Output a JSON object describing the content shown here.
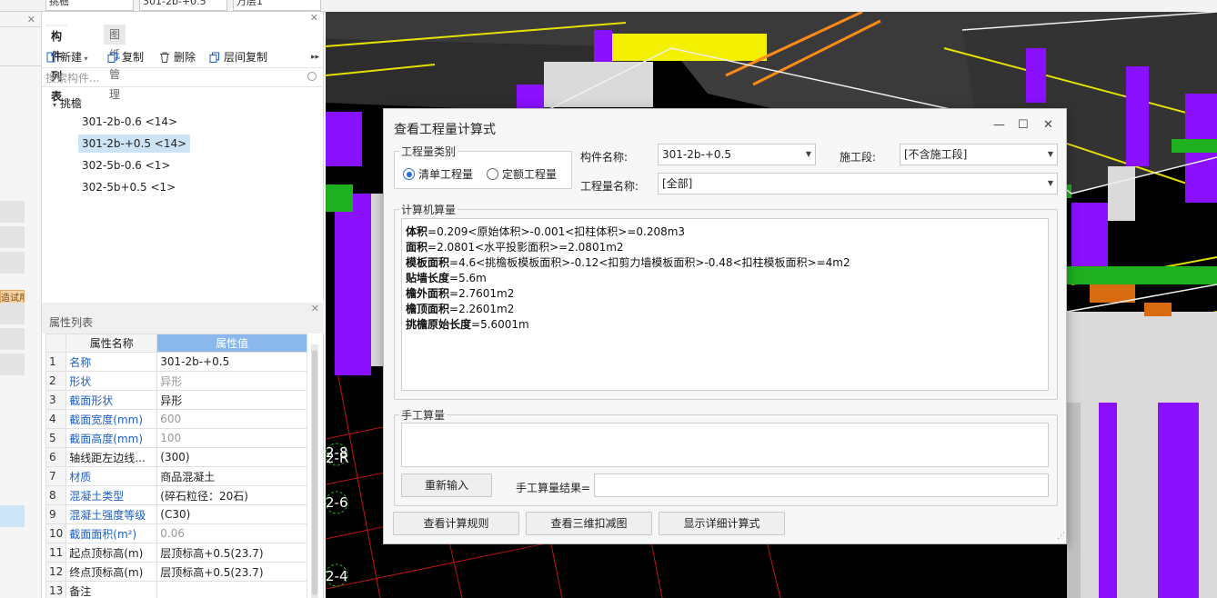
{
  "top_combos": [
    "挑檐",
    "301-2b-+0.5",
    "万层1"
  ],
  "left_strip": {
    "trial_label": "造试用"
  },
  "component_panel": {
    "tabs": [
      "构件列表",
      "图纸管理"
    ],
    "toolbar": {
      "new": "新建",
      "copy": "复制",
      "delete": "删除",
      "layer_copy": "层间复制"
    },
    "search_placeholder": "搜索构件...",
    "tree_root": "挑檐",
    "items": [
      "301-2b-0.6 <14>",
      "301-2b-+0.5 <14>",
      "302-5b-0.6 <1>",
      "302-5b+0.5 <1>"
    ],
    "selected_index": 1
  },
  "property_panel": {
    "title": "属性列表",
    "col_name": "属性名称",
    "col_value": "属性值",
    "rows": [
      {
        "n": "1",
        "name": "名称",
        "value": "301-2b-+0.5",
        "blue": true,
        "gray": false
      },
      {
        "n": "2",
        "name": "形状",
        "value": "异形",
        "blue": true,
        "gray": true
      },
      {
        "n": "3",
        "name": "截面形状",
        "value": "异形",
        "blue": true,
        "gray": false
      },
      {
        "n": "4",
        "name": "截面宽度(mm)",
        "value": "600",
        "blue": true,
        "gray": true
      },
      {
        "n": "5",
        "name": "截面高度(mm)",
        "value": "100",
        "blue": true,
        "gray": true
      },
      {
        "n": "6",
        "name": "轴线距左边线...",
        "value": "(300)",
        "blue": false,
        "gray": false
      },
      {
        "n": "7",
        "name": "材质",
        "value": "商品混凝土",
        "blue": true,
        "gray": false
      },
      {
        "n": "8",
        "name": "混凝土类型",
        "value": "(碎石粒径：20石)",
        "blue": true,
        "gray": false
      },
      {
        "n": "9",
        "name": "混凝土强度等级",
        "value": "(C30)",
        "blue": true,
        "gray": false
      },
      {
        "n": "10",
        "name": "截面面积(m²)",
        "value": "0.06",
        "blue": true,
        "gray": true
      },
      {
        "n": "11",
        "name": "起点顶标高(m)",
        "value": "层顶标高+0.5(23.7)",
        "blue": false,
        "gray": false
      },
      {
        "n": "12",
        "name": "终点顶标高(m)",
        "value": "层顶标高+0.5(23.7)",
        "blue": false,
        "gray": false
      },
      {
        "n": "13",
        "name": "备注",
        "value": "",
        "blue": false,
        "gray": false
      }
    ]
  },
  "view_labels": [
    "2-8",
    "2-R",
    "2-6",
    "2-4"
  ],
  "dialog": {
    "title": "查看工程量计算式",
    "window_buttons": [
      "—",
      "☐",
      "✕"
    ],
    "qty_type_label": "工程量类别",
    "radio_bill": "清单工程量",
    "radio_quota": "定额工程量",
    "component_name_label": "构件名称:",
    "component_name_value": "301-2b-+0.5",
    "section_label": "施工段:",
    "section_value": "[不含施工段]",
    "qty_name_label": "工程量名称:",
    "qty_name_value": "[全部]",
    "computer_calc_label": "计算机算量",
    "calc_lines": [
      {
        "key": "体积",
        "rest": "=0.209<原始体积>-0.001<扣柱体积>=0.208m3"
      },
      {
        "key": "面积",
        "rest": "=2.0801<水平投影面积>=2.0801m2"
      },
      {
        "key": "模板面积",
        "rest": "=4.6<挑檐板模板面积>-0.12<扣剪力墙模板面积>-0.48<扣柱模板面积>=4m2"
      },
      {
        "key": "贴墙长度",
        "rest": "=5.6m"
      },
      {
        "key": "檐外面积",
        "rest": "=2.7601m2"
      },
      {
        "key": "檐顶面积",
        "rest": "=2.2601m2"
      },
      {
        "key": "挑檐原始长度",
        "rest": "=5.6001m"
      }
    ],
    "manual_label": "手工算量",
    "reenter_button": "重新输入",
    "manual_result_label": "手工算量结果=",
    "rules_button": "查看计算规则",
    "view3d_button": "查看三维扣减图",
    "detail_button": "显示详细计算式"
  }
}
